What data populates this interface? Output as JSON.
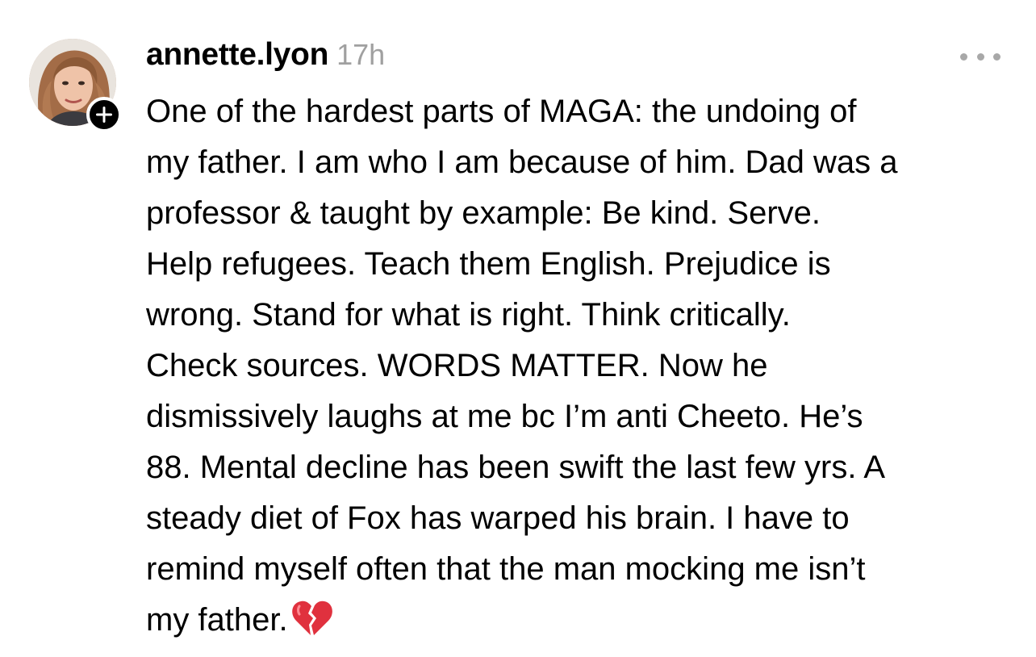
{
  "post": {
    "username": "annette.lyon",
    "timestamp": "17h",
    "avatar_icon": "profile-photo",
    "follow_icon": "plus-icon",
    "more_icon": "ellipsis-icon",
    "emoji": "broken-heart-icon",
    "text_lines": [
      "One of the hardest parts of MAGA:  the undoing of",
      "my father. I am who I am because of him. Dad was a",
      "professor & taught by example: Be kind. Serve.",
      "Help refugees. Teach them English. Prejudice is",
      "wrong. Stand for what is right. Think critically.",
      "Check sources. WORDS MATTER. Now he",
      "dismissively laughs at me bc I’m anti Cheeto. He’s",
      "88. Mental decline has been swift the last few yrs. A",
      "steady diet of Fox has warped his brain. I have to",
      "remind myself often that the man mocking me isn’t",
      "my father."
    ],
    "colors": {
      "text": "#000000",
      "secondary": "#a0a0a0",
      "heart": "#e0313e"
    }
  }
}
